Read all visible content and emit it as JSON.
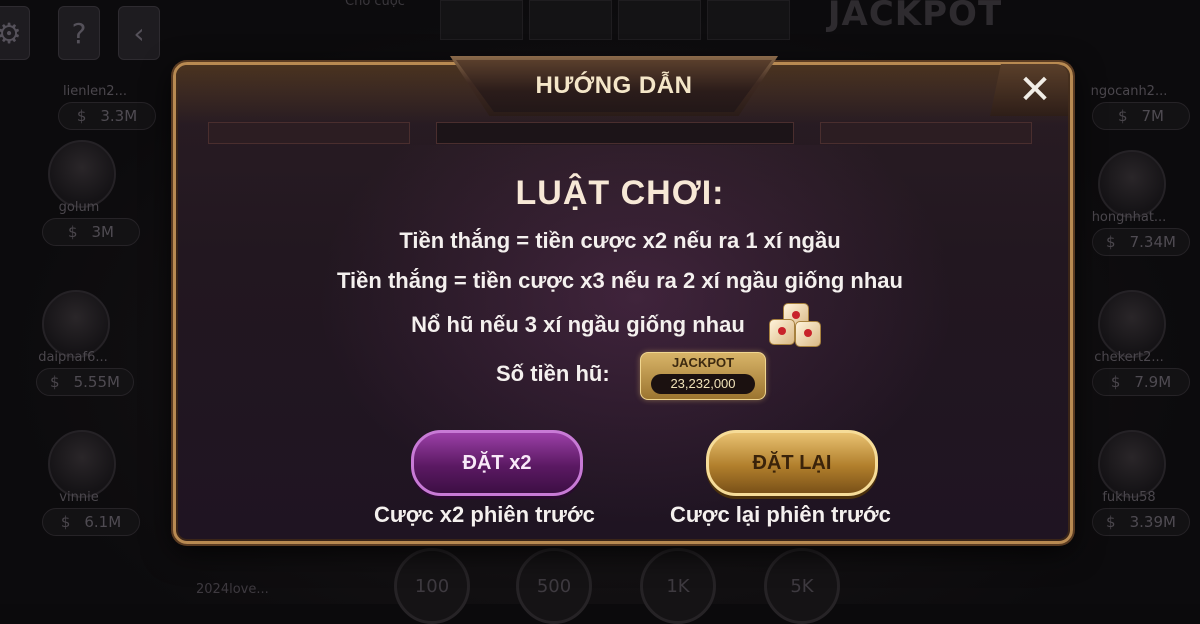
{
  "background": {
    "header_label": "Chờ cược",
    "jackpot_text": "JACKPOT",
    "players": [
      {
        "name": "lienlen2...",
        "money": "3.3M"
      },
      {
        "name": "golum",
        "money": "3M"
      },
      {
        "name": "daipnaf6...",
        "money": "5.55M"
      },
      {
        "name": "vinnie",
        "money": "6.1M"
      },
      {
        "name": "ngocanh2...",
        "money": "7M"
      },
      {
        "name": "hongnhat...",
        "money": "7.34M"
      },
      {
        "name": "chekert2...",
        "money": "7.9M"
      },
      {
        "name": "fukhu58",
        "money": "3.39M"
      }
    ],
    "bottom_name": "2024love...",
    "chips": [
      "100",
      "500",
      "1K",
      "5K"
    ],
    "help_icon": "help-icon",
    "back_icon": "back-icon",
    "settings_icon": "gear-icon"
  },
  "modal": {
    "title": "HƯỚNG DẪN",
    "close_label": "✕",
    "rules_title": "LUẬT CHƠI:",
    "rules": [
      "Tiền thắng = tiền cược x2 nếu ra 1 xí ngầu",
      "Tiền thắng = tiền cược x3 nếu ra 2 xí ngầu giống nhau",
      "Nổ hũ nếu 3 xí ngầu giống nhau"
    ],
    "jackpot_label": "Số tiền hũ:",
    "jackpot_badge_label": "JACKPOT",
    "jackpot_amount": "23,232,000",
    "buttons": {
      "double_label": "ĐẶT x2",
      "double_caption": "Cược x2 phiên trước",
      "rebet_label": "ĐẶT LẠI",
      "rebet_caption": "Cược lại phiên trước"
    }
  }
}
